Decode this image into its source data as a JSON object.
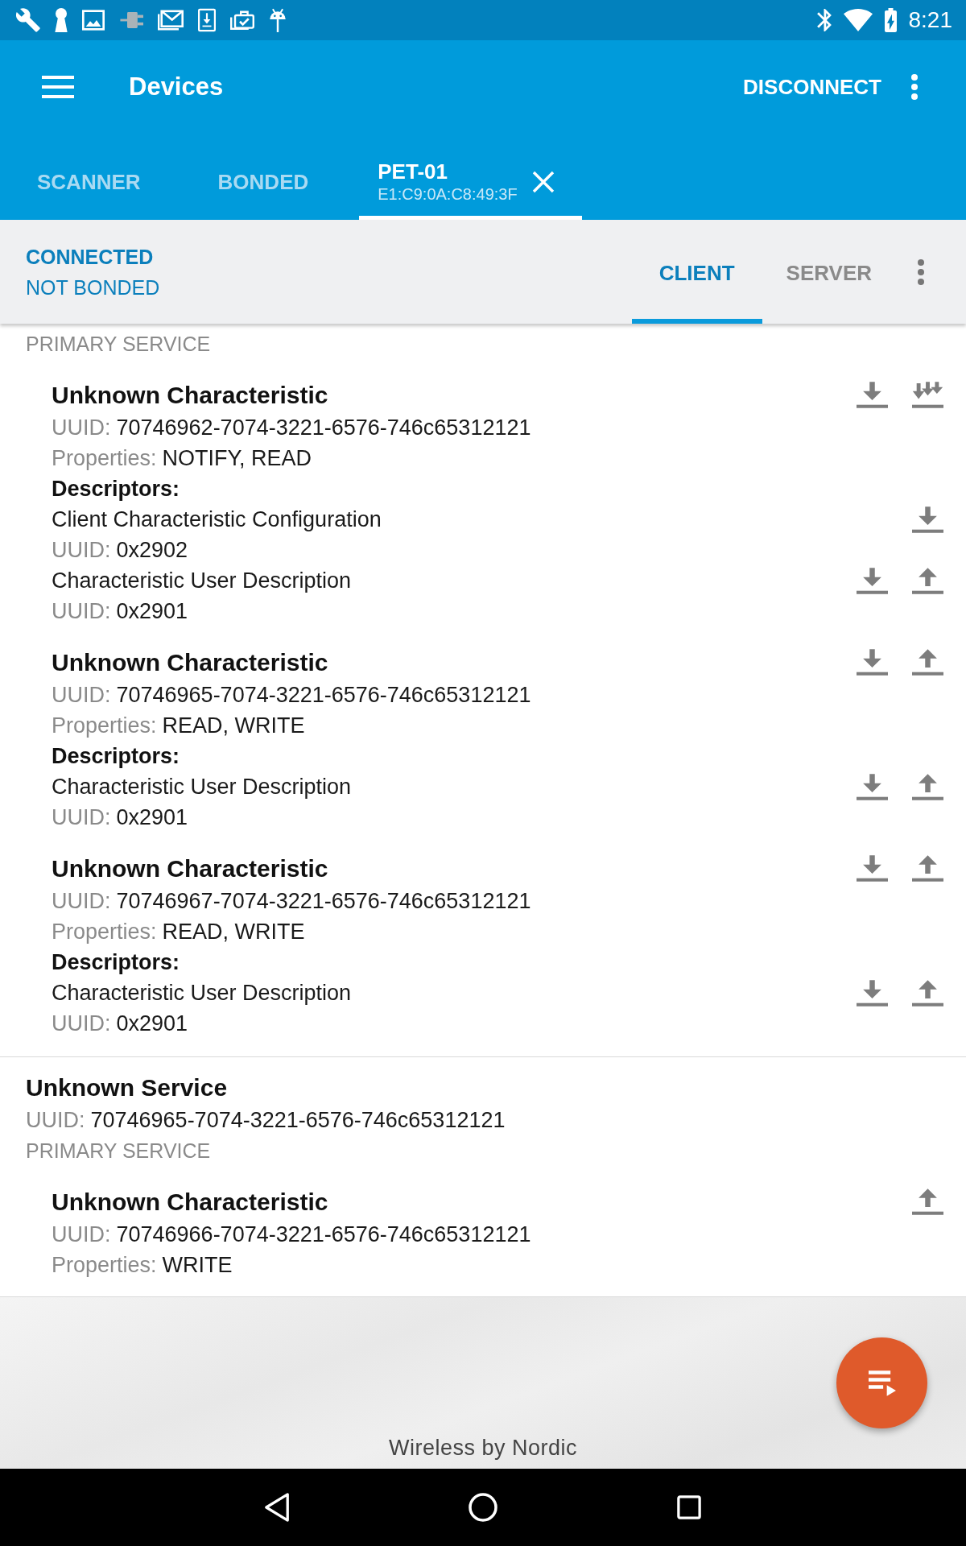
{
  "status_bar": {
    "time": "8:21"
  },
  "app_bar": {
    "title": "Devices",
    "action": "DISCONNECT"
  },
  "tabs": [
    {
      "label": "SCANNER",
      "selected": false,
      "closable": false
    },
    {
      "label": "BONDED",
      "selected": false,
      "closable": false
    },
    {
      "label": "PET-01",
      "address": "E1:C9:0A:C8:49:3F",
      "selected": true,
      "closable": true
    }
  ],
  "connection": {
    "state": "CONNECTED",
    "bond_state": "NOT BONDED"
  },
  "mode_tabs": [
    {
      "label": "CLIENT",
      "selected": true
    },
    {
      "label": "SERVER",
      "selected": false
    }
  ],
  "services": [
    {
      "type": "PRIMARY SERVICE",
      "characteristics": [
        {
          "name": "Unknown Characteristic",
          "uuid_label": "UUID:",
          "uuid": "70746962-7074-3221-6576-746c65312121",
          "properties_label": "Properties:",
          "properties": "NOTIFY, READ",
          "actions": [
            {
              "kind": "read"
            },
            {
              "kind": "notify"
            }
          ],
          "descriptors_label": "Descriptors:",
          "descriptors": [
            {
              "name": "Client Characteristic Configuration",
              "uuid_label": "UUID:",
              "uuid": "0x2902",
              "actions": [
                {
                  "kind": "read"
                }
              ]
            },
            {
              "name": "Characteristic User Description",
              "uuid_label": "UUID:",
              "uuid": "0x2901",
              "actions": [
                {
                  "kind": "read"
                },
                {
                  "kind": "write"
                }
              ]
            }
          ]
        },
        {
          "name": "Unknown Characteristic",
          "uuid_label": "UUID:",
          "uuid": "70746965-7074-3221-6576-746c65312121",
          "properties_label": "Properties:",
          "properties": "READ, WRITE",
          "actions": [
            {
              "kind": "read"
            },
            {
              "kind": "write"
            }
          ],
          "descriptors_label": "Descriptors:",
          "descriptors": [
            {
              "name": "Characteristic User Description",
              "uuid_label": "UUID:",
              "uuid": "0x2901",
              "actions": [
                {
                  "kind": "read"
                },
                {
                  "kind": "write"
                }
              ]
            }
          ]
        },
        {
          "name": "Unknown Characteristic",
          "uuid_label": "UUID:",
          "uuid": "70746967-7074-3221-6576-746c65312121",
          "properties_label": "Properties:",
          "properties": "READ, WRITE",
          "actions": [
            {
              "kind": "read"
            },
            {
              "kind": "write"
            }
          ],
          "descriptors_label": "Descriptors:",
          "descriptors": [
            {
              "name": "Characteristic User Description",
              "uuid_label": "UUID:",
              "uuid": "0x2901",
              "actions": [
                {
                  "kind": "read"
                },
                {
                  "kind": "write"
                }
              ]
            }
          ]
        }
      ]
    },
    {
      "name": "Unknown Service",
      "uuid_label": "UUID:",
      "uuid": "70746965-7074-3221-6576-746c65312121",
      "type": "PRIMARY SERVICE",
      "characteristics": [
        {
          "name": "Unknown Characteristic",
          "uuid_label": "UUID:",
          "uuid": "70746966-7074-3221-6576-746c65312121",
          "properties_label": "Properties:",
          "properties": "WRITE",
          "actions": [
            {
              "kind": "write"
            }
          ]
        }
      ]
    }
  ],
  "footer": {
    "text": "Wireless by Nordic"
  }
}
